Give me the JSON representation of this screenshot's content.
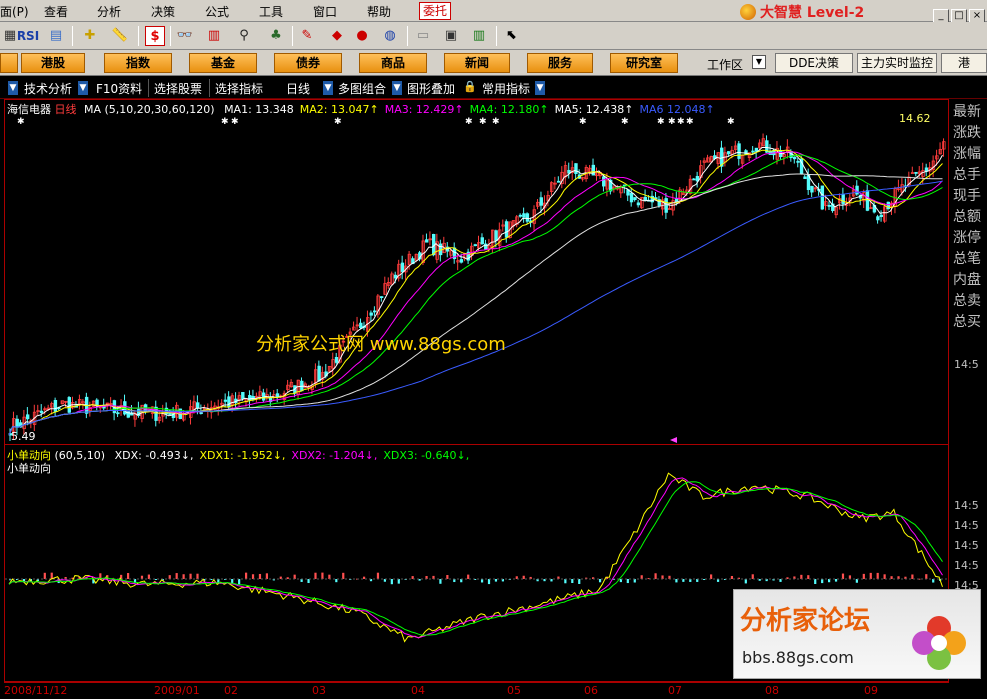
{
  "menu": {
    "items": [
      "面(P)",
      "查看",
      "分析",
      "决策",
      "公式",
      "工具",
      "窗口",
      "帮助"
    ],
    "delegate": "委托",
    "brand": "大智慧 Level-2"
  },
  "nav": {
    "buttons": [
      "港股",
      "指数",
      "基金",
      "债券",
      "商品",
      "新闻",
      "服务",
      "研究室"
    ],
    "workspace": "工作区",
    "right_buttons": [
      "DDE决策",
      "主力实时监控",
      "港"
    ]
  },
  "tabs": [
    "技术分析",
    "F10资料",
    "选择股票",
    "选择指标",
    "日线",
    "多图组合",
    "图形叠加",
    "常用指标"
  ],
  "main_chart": {
    "stock": "海信电器",
    "period": "日线",
    "ma_params": "MA (5,10,20,30,60,120)",
    "ma_values": [
      {
        "label": "MA1:",
        "value": "13.348",
        "color": "#ffffff"
      },
      {
        "label": "MA2:",
        "value": "13.047",
        "color": "#ffff00"
      },
      {
        "label": "MA3:",
        "value": "12.429",
        "color": "#ff00ff"
      },
      {
        "label": "MA4:",
        "value": "12.180",
        "color": "#00ff00"
      },
      {
        "label": "MA5:",
        "value": "12.438",
        "color": "#ffffff"
      },
      {
        "label": "MA6",
        "value": "12.048",
        "color": "#3a5bff"
      }
    ],
    "high_label": "14.62",
    "low_label": "5.49",
    "watermark": "分析家公式网  www.88gs.com"
  },
  "indicator": {
    "name": "小单动向",
    "params": "(60,5,10)",
    "values": [
      {
        "label": "XDX:",
        "value": "-0.493",
        "color": "#ffffff"
      },
      {
        "label": "XDX1:",
        "value": "-1.952",
        "color": "#ffff00"
      },
      {
        "label": "XDX2:",
        "value": "-1.204",
        "color": "#ff00ff"
      },
      {
        "label": "XDX3:",
        "value": "-0.640",
        "color": "#00ff00"
      }
    ],
    "subtitle": "小单动向"
  },
  "right_panel": {
    "labels": [
      "最新",
      "涨跌",
      "涨幅",
      "总手",
      "现手",
      "总额",
      "涨停",
      "总笔",
      "内盘",
      "总卖",
      "总买"
    ],
    "times": [
      "14:5",
      "14:5",
      "14:5",
      "14:5",
      "14:5",
      "14:5",
      "14:5"
    ]
  },
  "dates": [
    "2008/11/12",
    "2009/01",
    "02",
    "03",
    "04",
    "05",
    "06",
    "07",
    "08",
    "09"
  ],
  "forum": {
    "title": "分析家论坛",
    "url": "bbs.88gs.com"
  },
  "colors": {
    "up": "#ff3c3c",
    "down": "#54fcfc",
    "border": "#aa0000"
  }
}
